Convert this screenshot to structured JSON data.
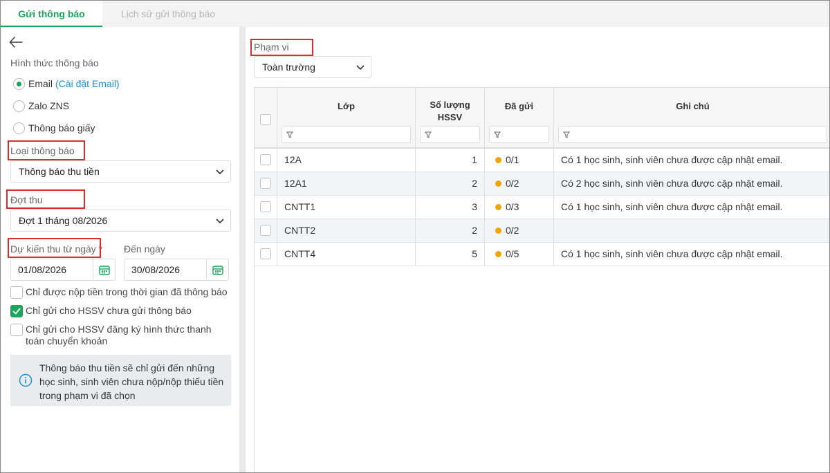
{
  "tabs": [
    {
      "label": "Gửi thông báo",
      "active": true
    },
    {
      "label": "Lịch sử gửi thông báo",
      "active": false
    }
  ],
  "left": {
    "notify_method_label": "Hình thức thông báo",
    "methods": [
      {
        "label": "Email",
        "link": "(Cài đặt Email)",
        "selected": true
      },
      {
        "label": "Zalo ZNS",
        "selected": false
      },
      {
        "label": "Thông báo giấy",
        "selected": false
      }
    ],
    "notify_type_label": "Loại thông báo",
    "notify_type_value": "Thông báo thu tiền",
    "period_label": "Đợt thu",
    "period_value": "Đợt 1 tháng 08/2026",
    "from_label": "Dự kiến thu từ ngày",
    "required_mark": "*",
    "from_value": "01/08/2026",
    "to_label": "Đến ngày",
    "to_value": "30/08/2026",
    "options": [
      {
        "label": "Chỉ được nộp tiền trong thời gian đã thông báo",
        "checked": false
      },
      {
        "label": "Chỉ gửi cho HSSV chưa gửi thông báo",
        "checked": true
      },
      {
        "label": "Chỉ gửi cho HSSV đăng ký hình thức thanh toán chuyển khoản",
        "checked": false
      }
    ],
    "info_text": "Thông báo thu tiền sẽ chỉ gửi đến những học sinh, sinh viên chưa nộp/nộp thiếu tiền trong phạm vi đã chọn"
  },
  "right": {
    "scope_label": "Phạm vi",
    "scope_value": "Toàn trường",
    "columns": [
      "Lớp",
      "Số lượng HSSV",
      "Đã gửi",
      "Ghi chú"
    ],
    "column_lines": [
      [
        "Lớp"
      ],
      [
        "Số lượng",
        "HSSV"
      ],
      [
        "Đã gửi"
      ],
      [
        "Ghi chú"
      ]
    ],
    "rows": [
      {
        "class": "12A",
        "count": "1",
        "sent": "0/1",
        "note": "Có 1 học sinh, sinh viên chưa được cập nhật email."
      },
      {
        "class": "12A1",
        "count": "2",
        "sent": "0/2",
        "note": "Có 2 học sinh, sinh viên chưa được cập nhật email."
      },
      {
        "class": "CNTT1",
        "count": "3",
        "sent": "0/3",
        "note": "Có 1 học sinh, sinh viên chưa được cập nhật email."
      },
      {
        "class": "CNTT2",
        "count": "2",
        "sent": "0/2",
        "note": ""
      },
      {
        "class": "CNTT4",
        "count": "5",
        "sent": "0/5",
        "note": "Có 1 học sinh, sinh viên chưa được cập nhật email."
      }
    ]
  },
  "colors": {
    "accent": "#1aa659",
    "link": "#1a8fd8",
    "highlight_border": "#d62d2d",
    "status_dot": "#f5a400"
  }
}
